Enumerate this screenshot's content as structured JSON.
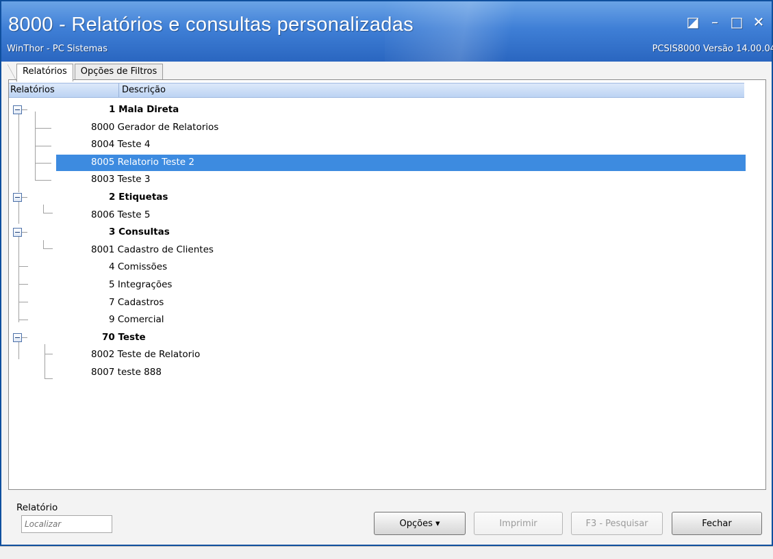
{
  "window": {
    "title": "8000 - Relatórios e consultas personalizadas",
    "subtitle": "WinThor - PC Sistemas",
    "version": "PCSIS8000  Versão 14.00.04",
    "controls": [
      "◪",
      "–",
      "□",
      "✕"
    ]
  },
  "tabs": [
    {
      "label": "Relatórios",
      "active": true
    },
    {
      "label": "Opções de Filtros",
      "active": false
    }
  ],
  "grid": {
    "columns": [
      "Relatórios",
      "Descrição"
    ],
    "rows": [
      {
        "type": "group",
        "text": "1 Mala Direta"
      },
      {
        "type": "item",
        "text": "8000 Gerador de Relatorios"
      },
      {
        "type": "item",
        "text": "8004 Teste 4"
      },
      {
        "type": "item",
        "text": "8005 Relatorio Teste 2",
        "selected": true
      },
      {
        "type": "item",
        "text": "8003 Teste 3"
      },
      {
        "type": "group",
        "text": "2 Etiquetas"
      },
      {
        "type": "item",
        "text": "8006 Teste 5"
      },
      {
        "type": "group",
        "text": "3 Consultas"
      },
      {
        "type": "item",
        "text": "8001 Cadastro de Clientes"
      },
      {
        "type": "sub",
        "text": "4 Comissões"
      },
      {
        "type": "sub",
        "text": "5 Integrações"
      },
      {
        "type": "sub",
        "text": "7 Cadastros"
      },
      {
        "type": "sub",
        "text": "9 Comercial"
      },
      {
        "type": "group",
        "text": "70 Teste"
      },
      {
        "type": "item",
        "text": "8002 Teste de Relatorio"
      },
      {
        "type": "item",
        "text": "8007 teste 888"
      }
    ]
  },
  "search": {
    "label": "Relatório",
    "placeholder": "Localizar"
  },
  "buttons": {
    "options": "Opções ▾",
    "print": "Imprimir",
    "search": "F3 - Pesquisar",
    "close": "Fechar"
  },
  "colors": {
    "title_bar": "#3f7fd6",
    "selection": "#3d8be0",
    "header": "#bcd3f3"
  }
}
